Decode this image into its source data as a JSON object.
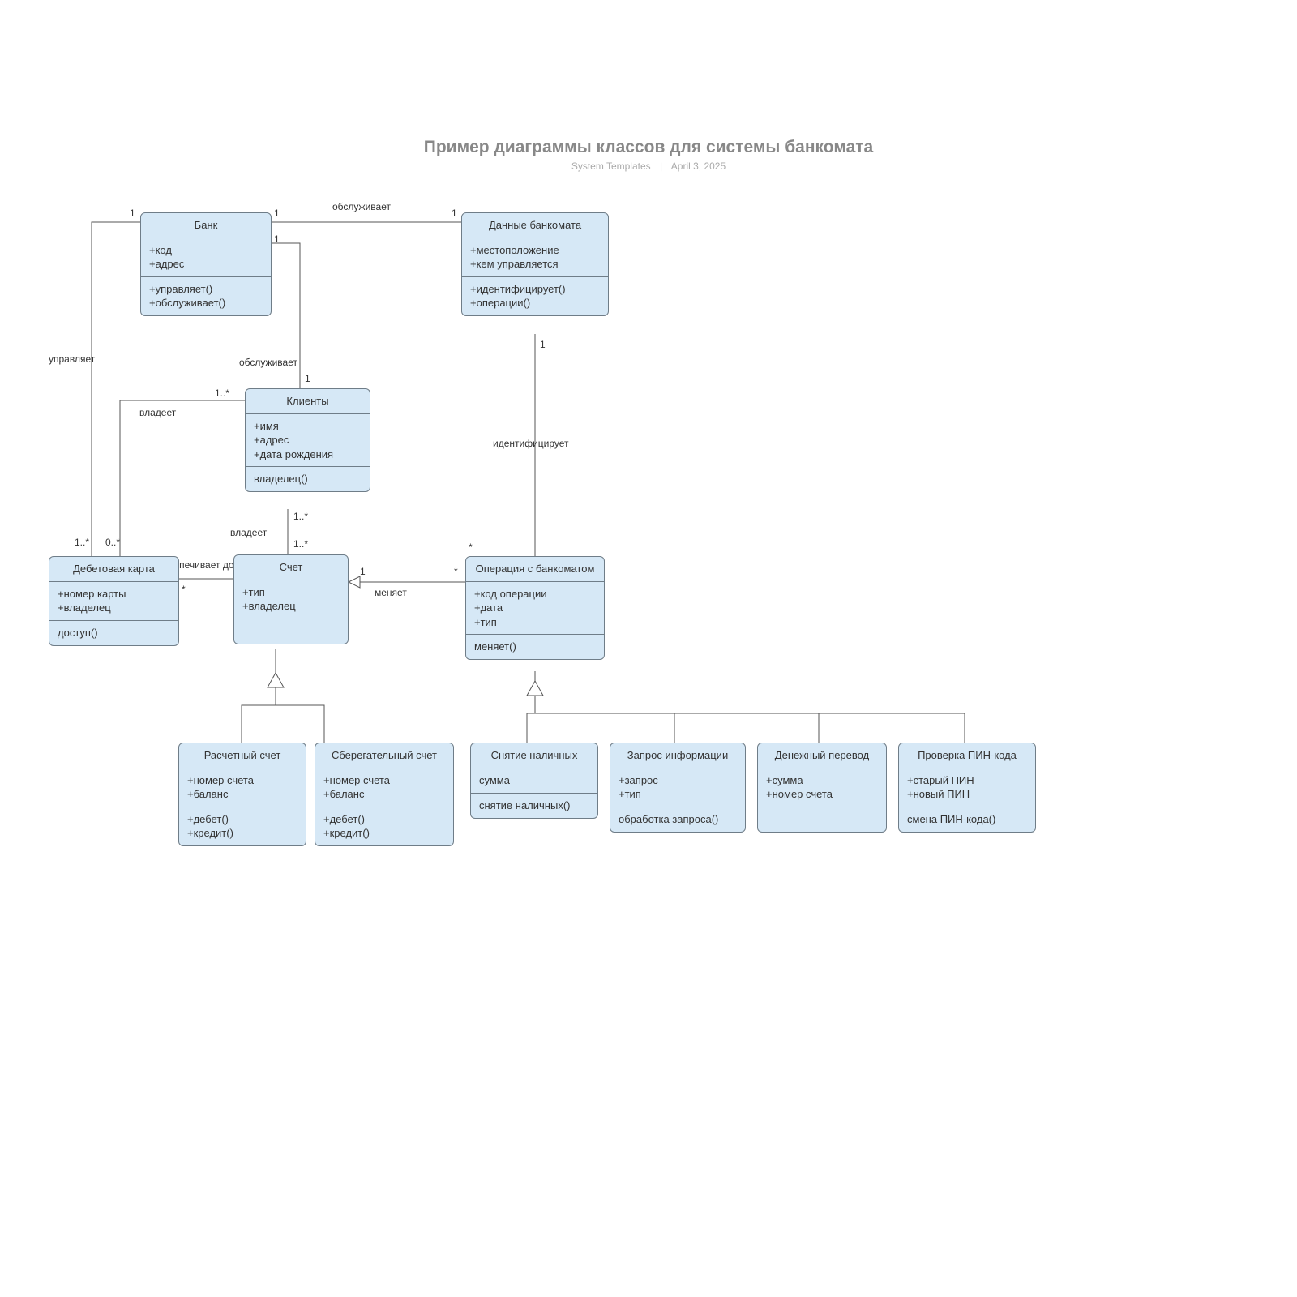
{
  "title": "Пример диаграммы классов для системы банкомата",
  "subtitle_author": "System Templates",
  "subtitle_date": "April 3, 2025",
  "classes": {
    "bank": {
      "name": "Банк",
      "attrs": [
        "+код",
        "+адрес"
      ],
      "ops": [
        "+управляет()",
        "+обслуживает()"
      ]
    },
    "atm": {
      "name": "Данные банкомата",
      "attrs": [
        "+местоположение",
        "+кем управляется"
      ],
      "ops": [
        "+идентифицирует()",
        "+операции()"
      ]
    },
    "client": {
      "name": "Клиенты",
      "attrs": [
        "+имя",
        "+адрес",
        "+дата рождения"
      ],
      "ops": [
        "владелец()"
      ]
    },
    "debit": {
      "name": "Дебетовая карта",
      "attrs": [
        "+номер карты",
        "+владелец"
      ],
      "ops": [
        "доступ()"
      ]
    },
    "account": {
      "name": "Счет",
      "attrs": [
        "+тип",
        "+владелец"
      ],
      "ops": [
        ""
      ]
    },
    "atmop": {
      "name": "Операция с банкоматом",
      "attrs": [
        "+код операции",
        "+дата",
        "+тип"
      ],
      "ops": [
        "меняет()"
      ]
    },
    "checking": {
      "name": "Расчетный счет",
      "attrs": [
        "+номер счета",
        "+баланс"
      ],
      "ops": [
        "+дебет()",
        "+кредит()"
      ]
    },
    "savings": {
      "name": "Сберегательный счет",
      "attrs": [
        "+номер счета",
        "+баланс"
      ],
      "ops": [
        "+дебет()",
        "+кредит()"
      ]
    },
    "withdraw": {
      "name": "Снятие наличных",
      "attrs": [
        "сумма"
      ],
      "ops": [
        "снятие наличных()"
      ]
    },
    "inquiry": {
      "name": "Запрос информации",
      "attrs": [
        "+запрос",
        "+тип"
      ],
      "ops": [
        "обработка запроса()"
      ]
    },
    "transfer": {
      "name": "Денежный перевод",
      "attrs": [
        "+сумма",
        "+номер счета"
      ],
      "ops": [
        ""
      ]
    },
    "pin": {
      "name": "Проверка ПИН-кода",
      "attrs": [
        "+старый ПИН",
        "+новый ПИН"
      ],
      "ops": [
        "смена ПИН-кода()"
      ]
    }
  },
  "labels": {
    "serves": "обслуживает",
    "manages": "управляет",
    "owns": "владеет",
    "identifies": "идентифицирует",
    "provides_access": "обеспечивает доступ к",
    "changes": "меняет",
    "one": "1",
    "one_star": "1..*",
    "zero_star": "0..*",
    "star": "*"
  }
}
